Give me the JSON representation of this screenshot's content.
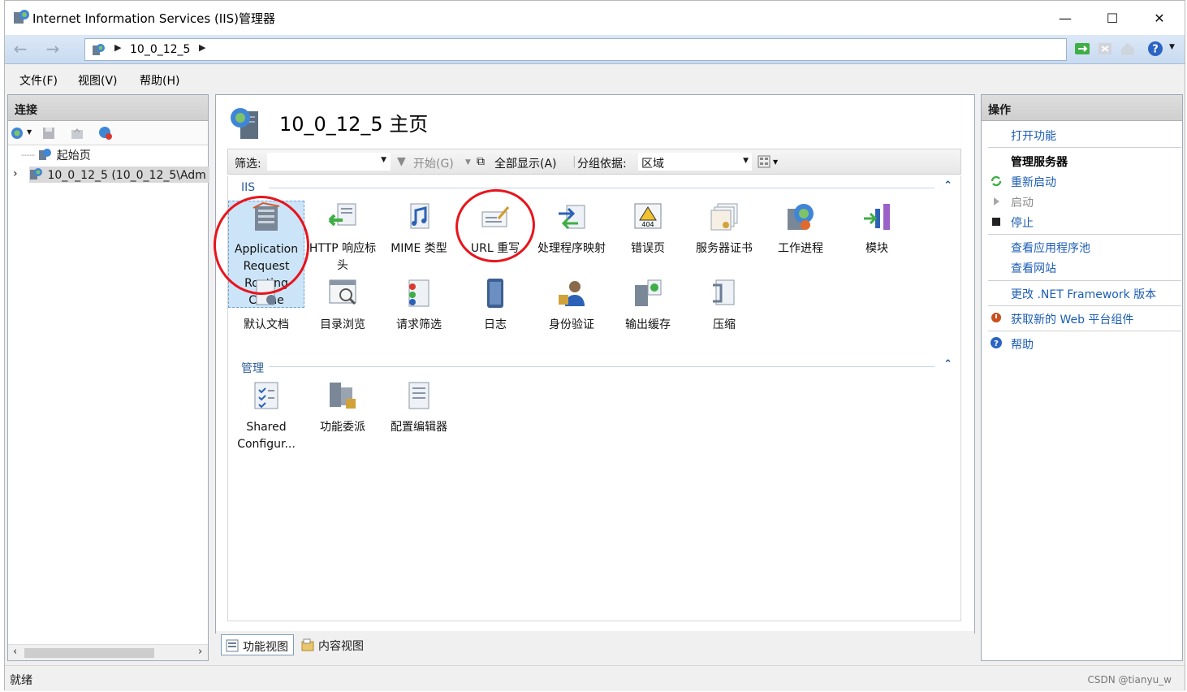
{
  "window": {
    "title": "Internet Information Services (IIS)管理器",
    "minimize": "—",
    "maximize": "☐",
    "close": "✕"
  },
  "address": {
    "crumb": "10_0_12_5"
  },
  "menu": [
    "文件(F)",
    "视图(V)",
    "帮助(H)"
  ],
  "connections": {
    "header": "连接",
    "tree": [
      {
        "label": "起始页"
      },
      {
        "label": "10_0_12_5 (10_0_12_5\\Adm"
      }
    ]
  },
  "center": {
    "title": "10_0_12_5 主页",
    "filter_label": "筛选:",
    "start_label": "开始(G)",
    "show_all_label": "全部显示(A)",
    "group_label": "分组依据:",
    "group_value": "区域",
    "sections": [
      {
        "name": "IIS",
        "items": [
          {
            "label": "Application Request Routing Cache",
            "icon": "server-routing-icon"
          },
          {
            "label": "HTTP 响应标头",
            "icon": "http-header-icon"
          },
          {
            "label": "MIME 类型",
            "icon": "mime-icon"
          },
          {
            "label": "URL 重写",
            "icon": "url-rewrite-icon"
          },
          {
            "label": "处理程序映射",
            "icon": "handler-icon"
          },
          {
            "label": "错误页",
            "icon": "error-page-icon"
          },
          {
            "label": "服务器证书",
            "icon": "certificate-icon"
          },
          {
            "label": "工作进程",
            "icon": "worker-process-icon"
          },
          {
            "label": "模块",
            "icon": "modules-icon"
          },
          {
            "label": "默认文档",
            "icon": "default-doc-icon"
          },
          {
            "label": "目录浏览",
            "icon": "dir-browse-icon"
          },
          {
            "label": "请求筛选",
            "icon": "request-filter-icon"
          },
          {
            "label": "日志",
            "icon": "logging-icon"
          },
          {
            "label": "身份验证",
            "icon": "auth-icon"
          },
          {
            "label": "输出缓存",
            "icon": "output-cache-icon"
          },
          {
            "label": "压缩",
            "icon": "compression-icon"
          }
        ]
      },
      {
        "name": "管理",
        "items": [
          {
            "label": "Shared Configur...",
            "icon": "shared-config-icon"
          },
          {
            "label": "功能委派",
            "icon": "delegation-icon"
          },
          {
            "label": "配置编辑器",
            "icon": "config-editor-icon"
          }
        ]
      }
    ],
    "tabs": [
      "功能视图",
      "内容视图"
    ]
  },
  "actions": {
    "header": "操作",
    "open_feature": "打开功能",
    "manage_server": "管理服务器",
    "restart": "重新启动",
    "start": "启动",
    "stop": "停止",
    "view_pools": "查看应用程序池",
    "view_sites": "查看网站",
    "change_net": "更改 .NET Framework 版本",
    "get_components": "获取新的 Web 平台组件",
    "help": "帮助"
  },
  "status": {
    "text": "就绪",
    "watermark": "CSDN @tianyu_w"
  },
  "colors": {
    "accent_link": "#1c5db5",
    "annotation": "#e8141c",
    "selection": "#cce4f7"
  }
}
